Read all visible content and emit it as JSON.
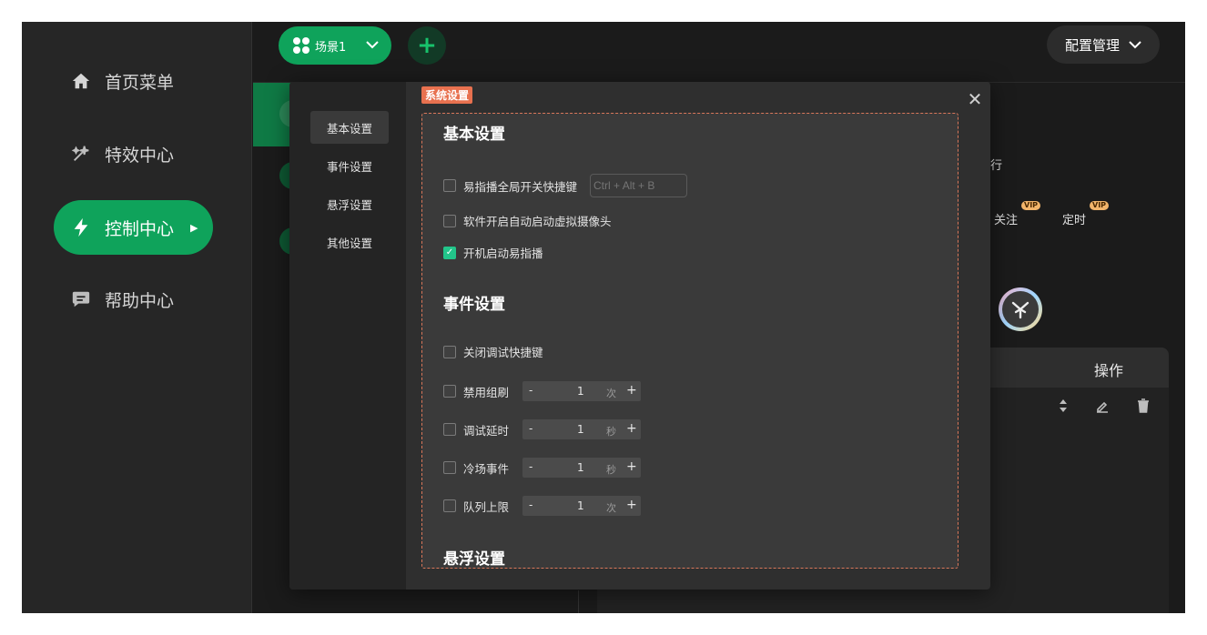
{
  "nav": {
    "items": [
      {
        "label": "首页菜单",
        "icon": "home-icon"
      },
      {
        "label": "特效中心",
        "icon": "effects-icon"
      },
      {
        "label": "控制中心",
        "icon": "lightning-icon",
        "active": true
      },
      {
        "label": "帮助中心",
        "icon": "chat-icon"
      }
    ]
  },
  "topbar": {
    "scene_label": "场景1",
    "add_label": "+",
    "config_label": "配置管理"
  },
  "background": {
    "row_text": "行",
    "follow_label": "关注",
    "timer_label": "定时",
    "vip_badge": "VIP",
    "ops_header": "操作"
  },
  "modal": {
    "tag": "系统设置",
    "close": "✕",
    "sidebar": [
      {
        "label": "基本设置",
        "active": true
      },
      {
        "label": "事件设置"
      },
      {
        "label": "悬浮设置"
      },
      {
        "label": "其他设置"
      }
    ],
    "sections": {
      "basic_title": "基本设置",
      "event_title": "事件设置",
      "float_title": "悬浮设置"
    },
    "basic_options": [
      {
        "label": "易指播全局开关快捷键",
        "checked": false,
        "hotkey_placeholder": "Ctrl + Alt + B"
      },
      {
        "label": "软件开启自动启动虚拟摄像头",
        "checked": false
      },
      {
        "label": "开机启动易指播",
        "checked": true
      }
    ],
    "event_options": {
      "close_debug": {
        "label": "关闭调试快捷键",
        "checked": false
      },
      "steppers": [
        {
          "label": "禁用组刷",
          "value": "1",
          "unit": "次",
          "minus": "-",
          "plus": "+"
        },
        {
          "label": "调试延时",
          "value": "1",
          "unit": "秒",
          "minus": "-",
          "plus": "+"
        },
        {
          "label": "冷场事件",
          "value": "1",
          "unit": "秒",
          "minus": "-",
          "plus": "+"
        },
        {
          "label": "队列上限",
          "value": "1",
          "unit": "次",
          "minus": "-",
          "plus": "+"
        }
      ]
    }
  },
  "colors": {
    "accent": "#0fa35b",
    "tag": "#e8714f",
    "check": "#22c58a"
  }
}
